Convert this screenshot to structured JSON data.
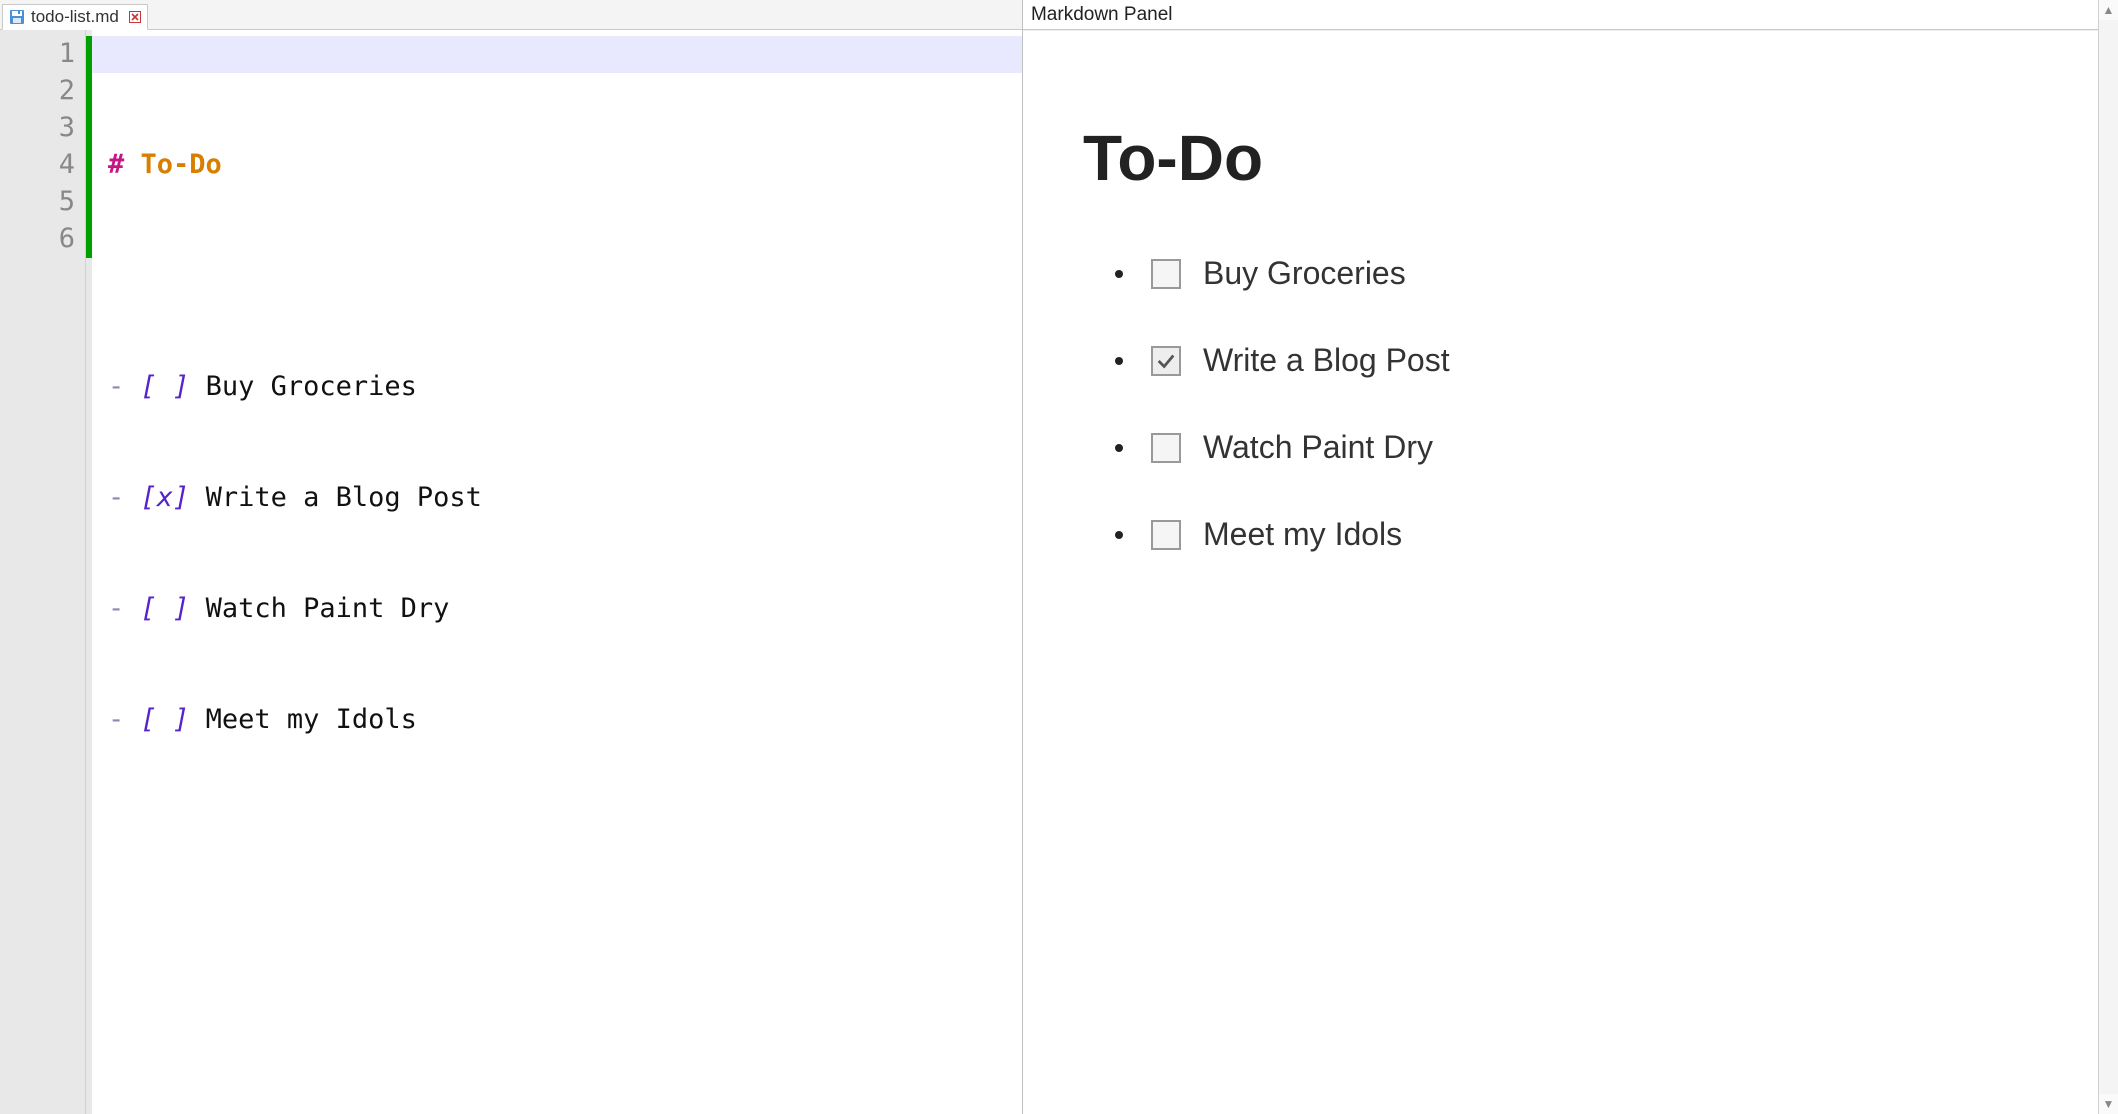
{
  "tab": {
    "filename": "todo-list.md"
  },
  "editor": {
    "line_count": 6,
    "lines": [
      {
        "n": "1",
        "kind": "heading",
        "marker": "#",
        "text": "To-Do"
      },
      {
        "n": "2",
        "kind": "blank"
      },
      {
        "n": "3",
        "kind": "task",
        "bullet": "-",
        "box": "[ ]",
        "text": "Buy Groceries"
      },
      {
        "n": "4",
        "kind": "task",
        "bullet": "-",
        "box": "[x]",
        "text": "Write a Blog Post"
      },
      {
        "n": "5",
        "kind": "task",
        "bullet": "-",
        "box": "[ ]",
        "text": "Watch Paint Dry"
      },
      {
        "n": "6",
        "kind": "task",
        "bullet": "-",
        "box": "[ ]",
        "text": "Meet my Idols"
      }
    ]
  },
  "preview": {
    "panel_title": "Markdown Panel",
    "heading": "To-Do",
    "items": [
      {
        "checked": false,
        "label": "Buy Groceries"
      },
      {
        "checked": true,
        "label": "Write a Blog Post"
      },
      {
        "checked": false,
        "label": "Watch Paint Dry"
      },
      {
        "checked": false,
        "label": "Meet my Idols"
      }
    ]
  }
}
